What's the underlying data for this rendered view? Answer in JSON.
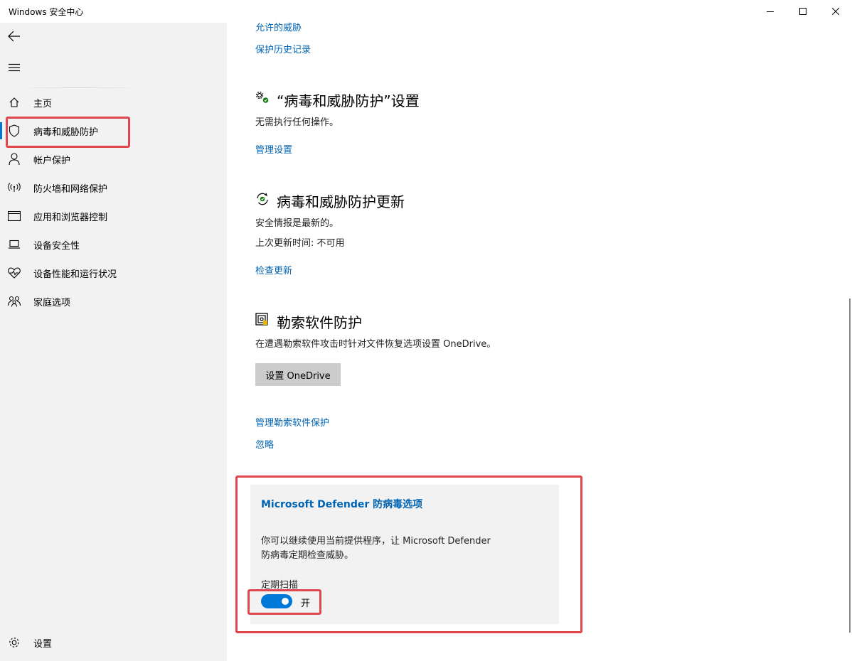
{
  "window": {
    "title": "Windows 安全中心"
  },
  "sidebar": {
    "items": [
      {
        "label": "主页",
        "icon": "home-icon"
      },
      {
        "label": "病毒和威胁防护",
        "icon": "shield-icon",
        "active": true
      },
      {
        "label": "帐户保护",
        "icon": "person-icon"
      },
      {
        "label": "防火墙和网络保护",
        "icon": "wifi-icon"
      },
      {
        "label": "应用和浏览器控制",
        "icon": "app-browser-icon"
      },
      {
        "label": "设备安全性",
        "icon": "laptop-icon"
      },
      {
        "label": "设备性能和运行状况",
        "icon": "heart-icon"
      },
      {
        "label": "家庭选项",
        "icon": "family-icon"
      }
    ],
    "settings_label": "设置"
  },
  "main": {
    "top_links": [
      "允许的威胁",
      "保护历史记录"
    ],
    "settings_section": {
      "title": "“病毒和威胁防护”设置",
      "status": "无需执行任何操作。",
      "link": "管理设置"
    },
    "updates_section": {
      "title": "病毒和威胁防护更新",
      "status": "安全情报是最新的。",
      "last_update": "上次更新时间: 不可用",
      "link": "检查更新"
    },
    "ransomware_section": {
      "title": "勒索软件防护",
      "description": "在遭遇勒索软件攻击时针对文件恢复选项设置 OneDrive。",
      "button_label": "设置 OneDrive",
      "links": [
        "管理勒索软件保护",
        "忽略"
      ]
    },
    "defender_panel": {
      "title": "Microsoft Defender 防病毒选项",
      "description": "你可以继续使用当前提供程序，让 Microsoft Defender 防病毒定期检查威胁。",
      "toggle_label": "定期扫描",
      "toggle_state": "开",
      "toggle_on": true
    }
  },
  "colors": {
    "accent": "#0078d7",
    "link": "#0063b1",
    "highlight": "#e0474c"
  }
}
